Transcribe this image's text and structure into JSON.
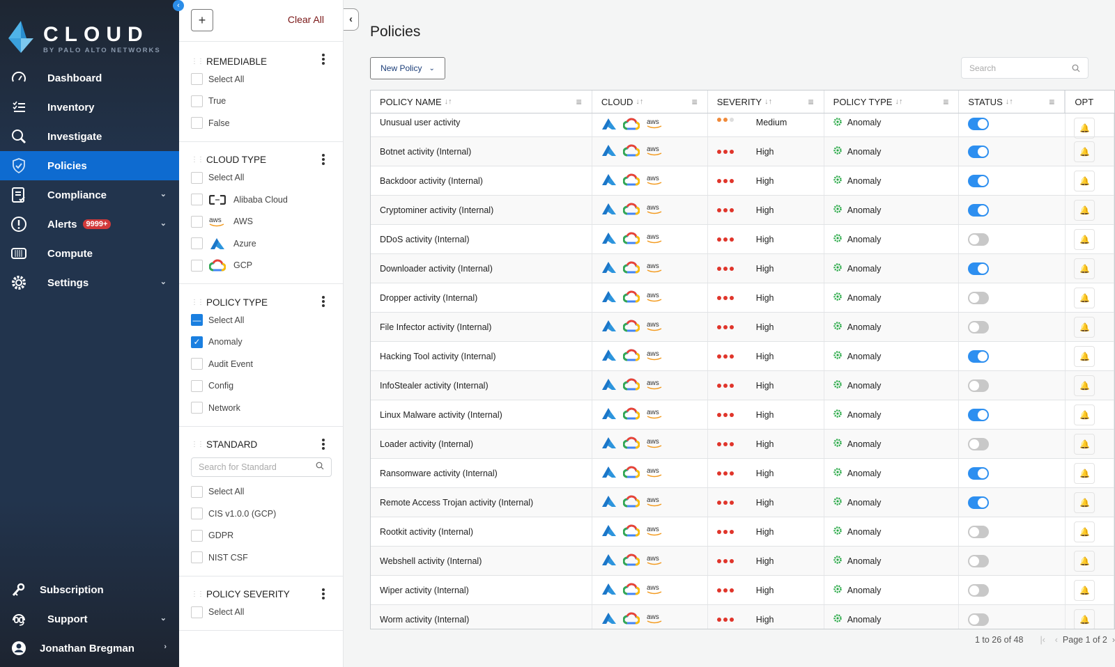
{
  "brand": {
    "name": "CLOUD",
    "tagline": "BY PALO ALTO NETWORKS"
  },
  "sidebar": {
    "items": [
      {
        "label": "Dashboard",
        "icon": "dashboard-gauge-icon",
        "active": false,
        "chevron": false
      },
      {
        "label": "Inventory",
        "icon": "inventory-list-icon",
        "active": false,
        "chevron": false
      },
      {
        "label": "Investigate",
        "icon": "search-icon",
        "active": false,
        "chevron": false
      },
      {
        "label": "Policies",
        "icon": "shield-check-icon",
        "active": true,
        "chevron": false
      },
      {
        "label": "Compliance",
        "icon": "compliance-report-icon",
        "active": false,
        "chevron": true
      },
      {
        "label": "Alerts",
        "icon": "alert-circle-icon",
        "active": false,
        "chevron": true,
        "badge": "9999+"
      },
      {
        "label": "Compute",
        "icon": "compute-container-icon",
        "active": false,
        "chevron": false
      },
      {
        "label": "Settings",
        "icon": "gear-icon",
        "active": false,
        "chevron": true
      }
    ],
    "bottom": [
      {
        "label": "Subscription",
        "icon": "key-icon",
        "chevron": ""
      },
      {
        "label": "Support",
        "icon": "headset-icon",
        "chevron": "down"
      },
      {
        "label": "Jonathan Bregman",
        "icon": "user-avatar-icon",
        "chevron": "right"
      }
    ]
  },
  "filters": {
    "clear_all": "Clear All",
    "add": "+",
    "sections": {
      "remediable": {
        "title": "REMEDIABLE",
        "options": [
          {
            "label": "Select All",
            "state": "unchecked"
          },
          {
            "label": "True",
            "state": "unchecked"
          },
          {
            "label": "False",
            "state": "unchecked"
          }
        ]
      },
      "cloud_type": {
        "title": "CLOUD TYPE",
        "options": [
          {
            "label": "Select All",
            "state": "unchecked",
            "icon": ""
          },
          {
            "label": "Alibaba Cloud",
            "state": "unchecked",
            "icon": "alibaba-cloud-icon"
          },
          {
            "label": "AWS",
            "state": "unchecked",
            "icon": "aws-icon"
          },
          {
            "label": "Azure",
            "state": "unchecked",
            "icon": "azure-icon"
          },
          {
            "label": "GCP",
            "state": "unchecked",
            "icon": "gcp-icon"
          }
        ]
      },
      "policy_type": {
        "title": "POLICY TYPE",
        "options": [
          {
            "label": "Select All",
            "state": "indeterminate"
          },
          {
            "label": "Anomaly",
            "state": "checked"
          },
          {
            "label": "Audit Event",
            "state": "unchecked"
          },
          {
            "label": "Config",
            "state": "unchecked"
          },
          {
            "label": "Network",
            "state": "unchecked"
          }
        ]
      },
      "standard": {
        "title": "STANDARD",
        "search_placeholder": "Search for Standard",
        "options": [
          {
            "label": "Select All",
            "state": "unchecked"
          },
          {
            "label": "CIS v1.0.0 (GCP)",
            "state": "unchecked"
          },
          {
            "label": "GDPR",
            "state": "unchecked"
          },
          {
            "label": "NIST CSF",
            "state": "unchecked"
          }
        ]
      },
      "policy_severity": {
        "title": "POLICY SEVERITY",
        "options": [
          {
            "label": "Select All",
            "state": "unchecked"
          }
        ]
      }
    }
  },
  "main": {
    "title": "Policies",
    "new_policy": "New Policy",
    "search_placeholder": "Search",
    "columns": [
      "POLICY NAME",
      "CLOUD",
      "SEVERITY",
      "POLICY TYPE",
      "STATUS",
      "OPT"
    ],
    "rows": [
      {
        "name": "Unusual user activity",
        "severity": "Medium",
        "type": "Anomaly",
        "enabled": true
      },
      {
        "name": "Botnet activity (Internal)",
        "severity": "High",
        "type": "Anomaly",
        "enabled": true
      },
      {
        "name": "Backdoor activity (Internal)",
        "severity": "High",
        "type": "Anomaly",
        "enabled": true
      },
      {
        "name": "Cryptominer activity (Internal)",
        "severity": "High",
        "type": "Anomaly",
        "enabled": true
      },
      {
        "name": "DDoS activity (Internal)",
        "severity": "High",
        "type": "Anomaly",
        "enabled": false
      },
      {
        "name": "Downloader activity (Internal)",
        "severity": "High",
        "type": "Anomaly",
        "enabled": true
      },
      {
        "name": "Dropper activity (Internal)",
        "severity": "High",
        "type": "Anomaly",
        "enabled": false
      },
      {
        "name": "File Infector activity (Internal)",
        "severity": "High",
        "type": "Anomaly",
        "enabled": false
      },
      {
        "name": "Hacking Tool activity (Internal)",
        "severity": "High",
        "type": "Anomaly",
        "enabled": true
      },
      {
        "name": "InfoStealer activity (Internal)",
        "severity": "High",
        "type": "Anomaly",
        "enabled": false
      },
      {
        "name": "Linux Malware activity (Internal)",
        "severity": "High",
        "type": "Anomaly",
        "enabled": true
      },
      {
        "name": "Loader activity (Internal)",
        "severity": "High",
        "type": "Anomaly",
        "enabled": false
      },
      {
        "name": "Ransomware activity (Internal)",
        "severity": "High",
        "type": "Anomaly",
        "enabled": true
      },
      {
        "name": "Remote Access Trojan activity (Internal)",
        "severity": "High",
        "type": "Anomaly",
        "enabled": true
      },
      {
        "name": "Rootkit activity (Internal)",
        "severity": "High",
        "type": "Anomaly",
        "enabled": false
      },
      {
        "name": "Webshell activity (Internal)",
        "severity": "High",
        "type": "Anomaly",
        "enabled": false
      },
      {
        "name": "Wiper activity (Internal)",
        "severity": "High",
        "type": "Anomaly",
        "enabled": false
      },
      {
        "name": "Worm activity (Internal)",
        "severity": "High",
        "type": "Anomaly",
        "enabled": false
      }
    ],
    "pagination": {
      "range": "1 to 26 of 48",
      "page": "Page 1 of 2"
    }
  },
  "colors": {
    "accent": "#0e6bd0",
    "high": "#e0352b",
    "medium": "#f08a3a",
    "anomaly": "#27a845",
    "toggle_on": "#2d8ff0"
  }
}
